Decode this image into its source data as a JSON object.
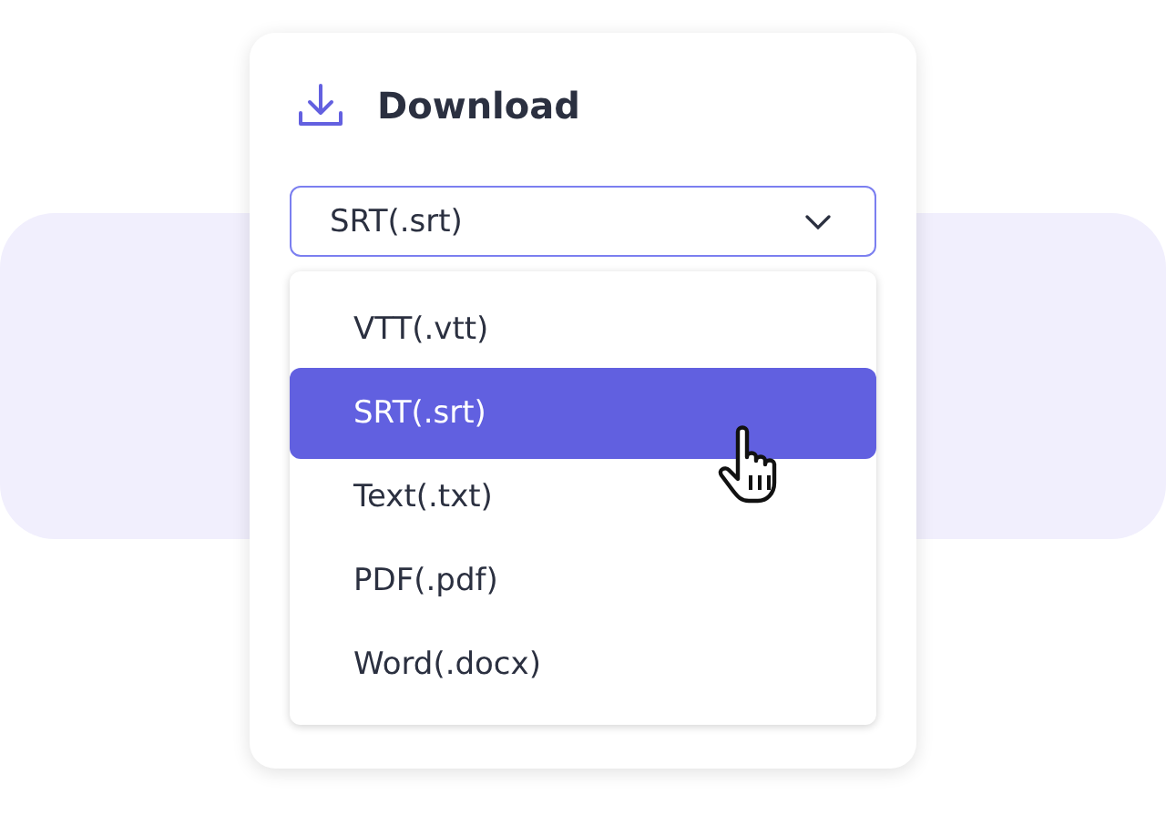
{
  "title": "Download",
  "select": {
    "value": "SRT(.srt)"
  },
  "options": [
    {
      "label": "VTT(.vtt)",
      "selected": false
    },
    {
      "label": "SRT(.srt)",
      "selected": true
    },
    {
      "label": "Text(.txt)",
      "selected": false
    },
    {
      "label": "PDF(.pdf)",
      "selected": false
    },
    {
      "label": "Word(.docx)",
      "selected": false
    }
  ]
}
